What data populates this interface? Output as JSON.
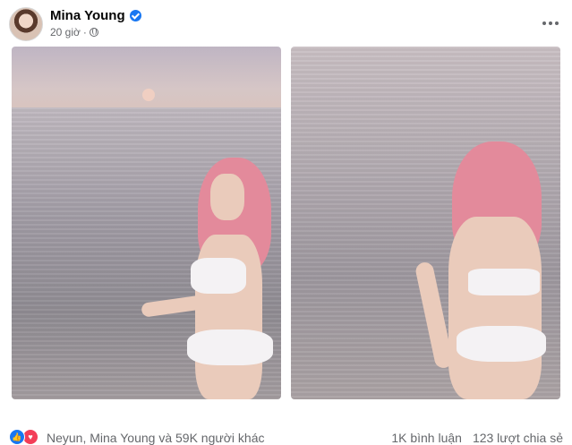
{
  "post": {
    "author": "Mina Young",
    "time": "20 giờ",
    "separator": "·",
    "privacy_icon": "globe-icon",
    "more_icon": "more-horizontal-icon"
  },
  "photos": [
    {
      "alt": "photo-sunset-sea-front"
    },
    {
      "alt": "photo-sea-back"
    }
  ],
  "footer": {
    "reactions_text": "Neyun, Mina Young và 59K người khác",
    "comments": "1K bình luận",
    "shares": "123 lượt chia sẻ",
    "reaction_icons": [
      "like-icon",
      "love-icon"
    ]
  },
  "colors": {
    "verified": "#1877f2",
    "like": "#1877f2",
    "love": "#f33e58",
    "secondary_text": "#65676b"
  }
}
